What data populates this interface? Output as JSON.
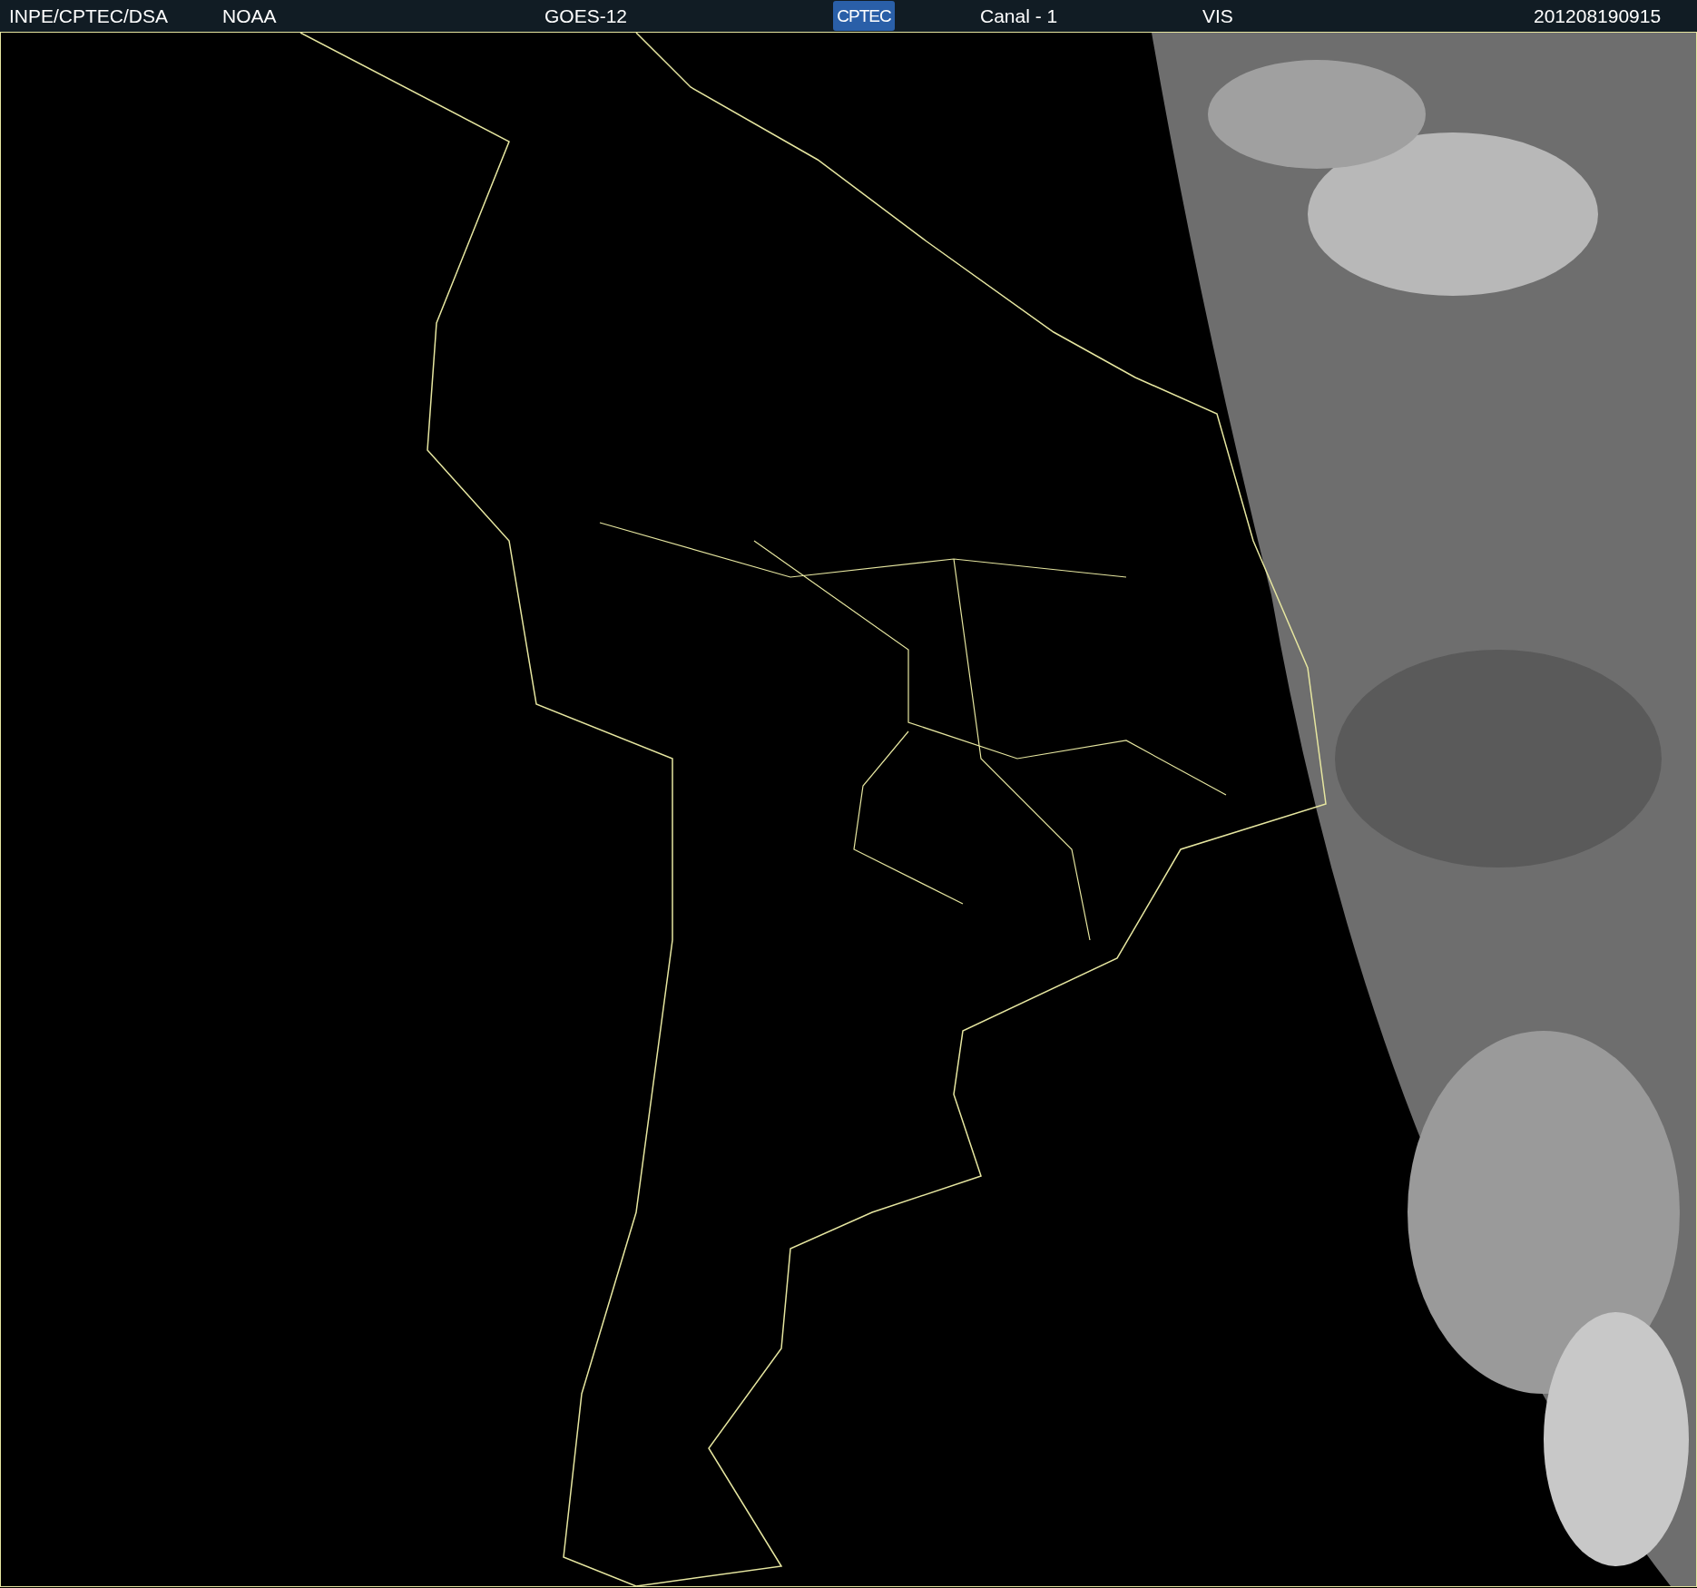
{
  "header": {
    "items": [
      {
        "kind": "text",
        "text": "INPE/CPTEC/DSA"
      },
      {
        "kind": "text",
        "text": "NOAA"
      },
      {
        "kind": "text",
        "text": "GOES-12"
      },
      {
        "kind": "logo",
        "text": "CPTEC"
      },
      {
        "kind": "text",
        "text": "Canal - 1"
      },
      {
        "kind": "text",
        "text": "VIS"
      },
      {
        "kind": "text",
        "text": "201208190915"
      }
    ]
  }
}
